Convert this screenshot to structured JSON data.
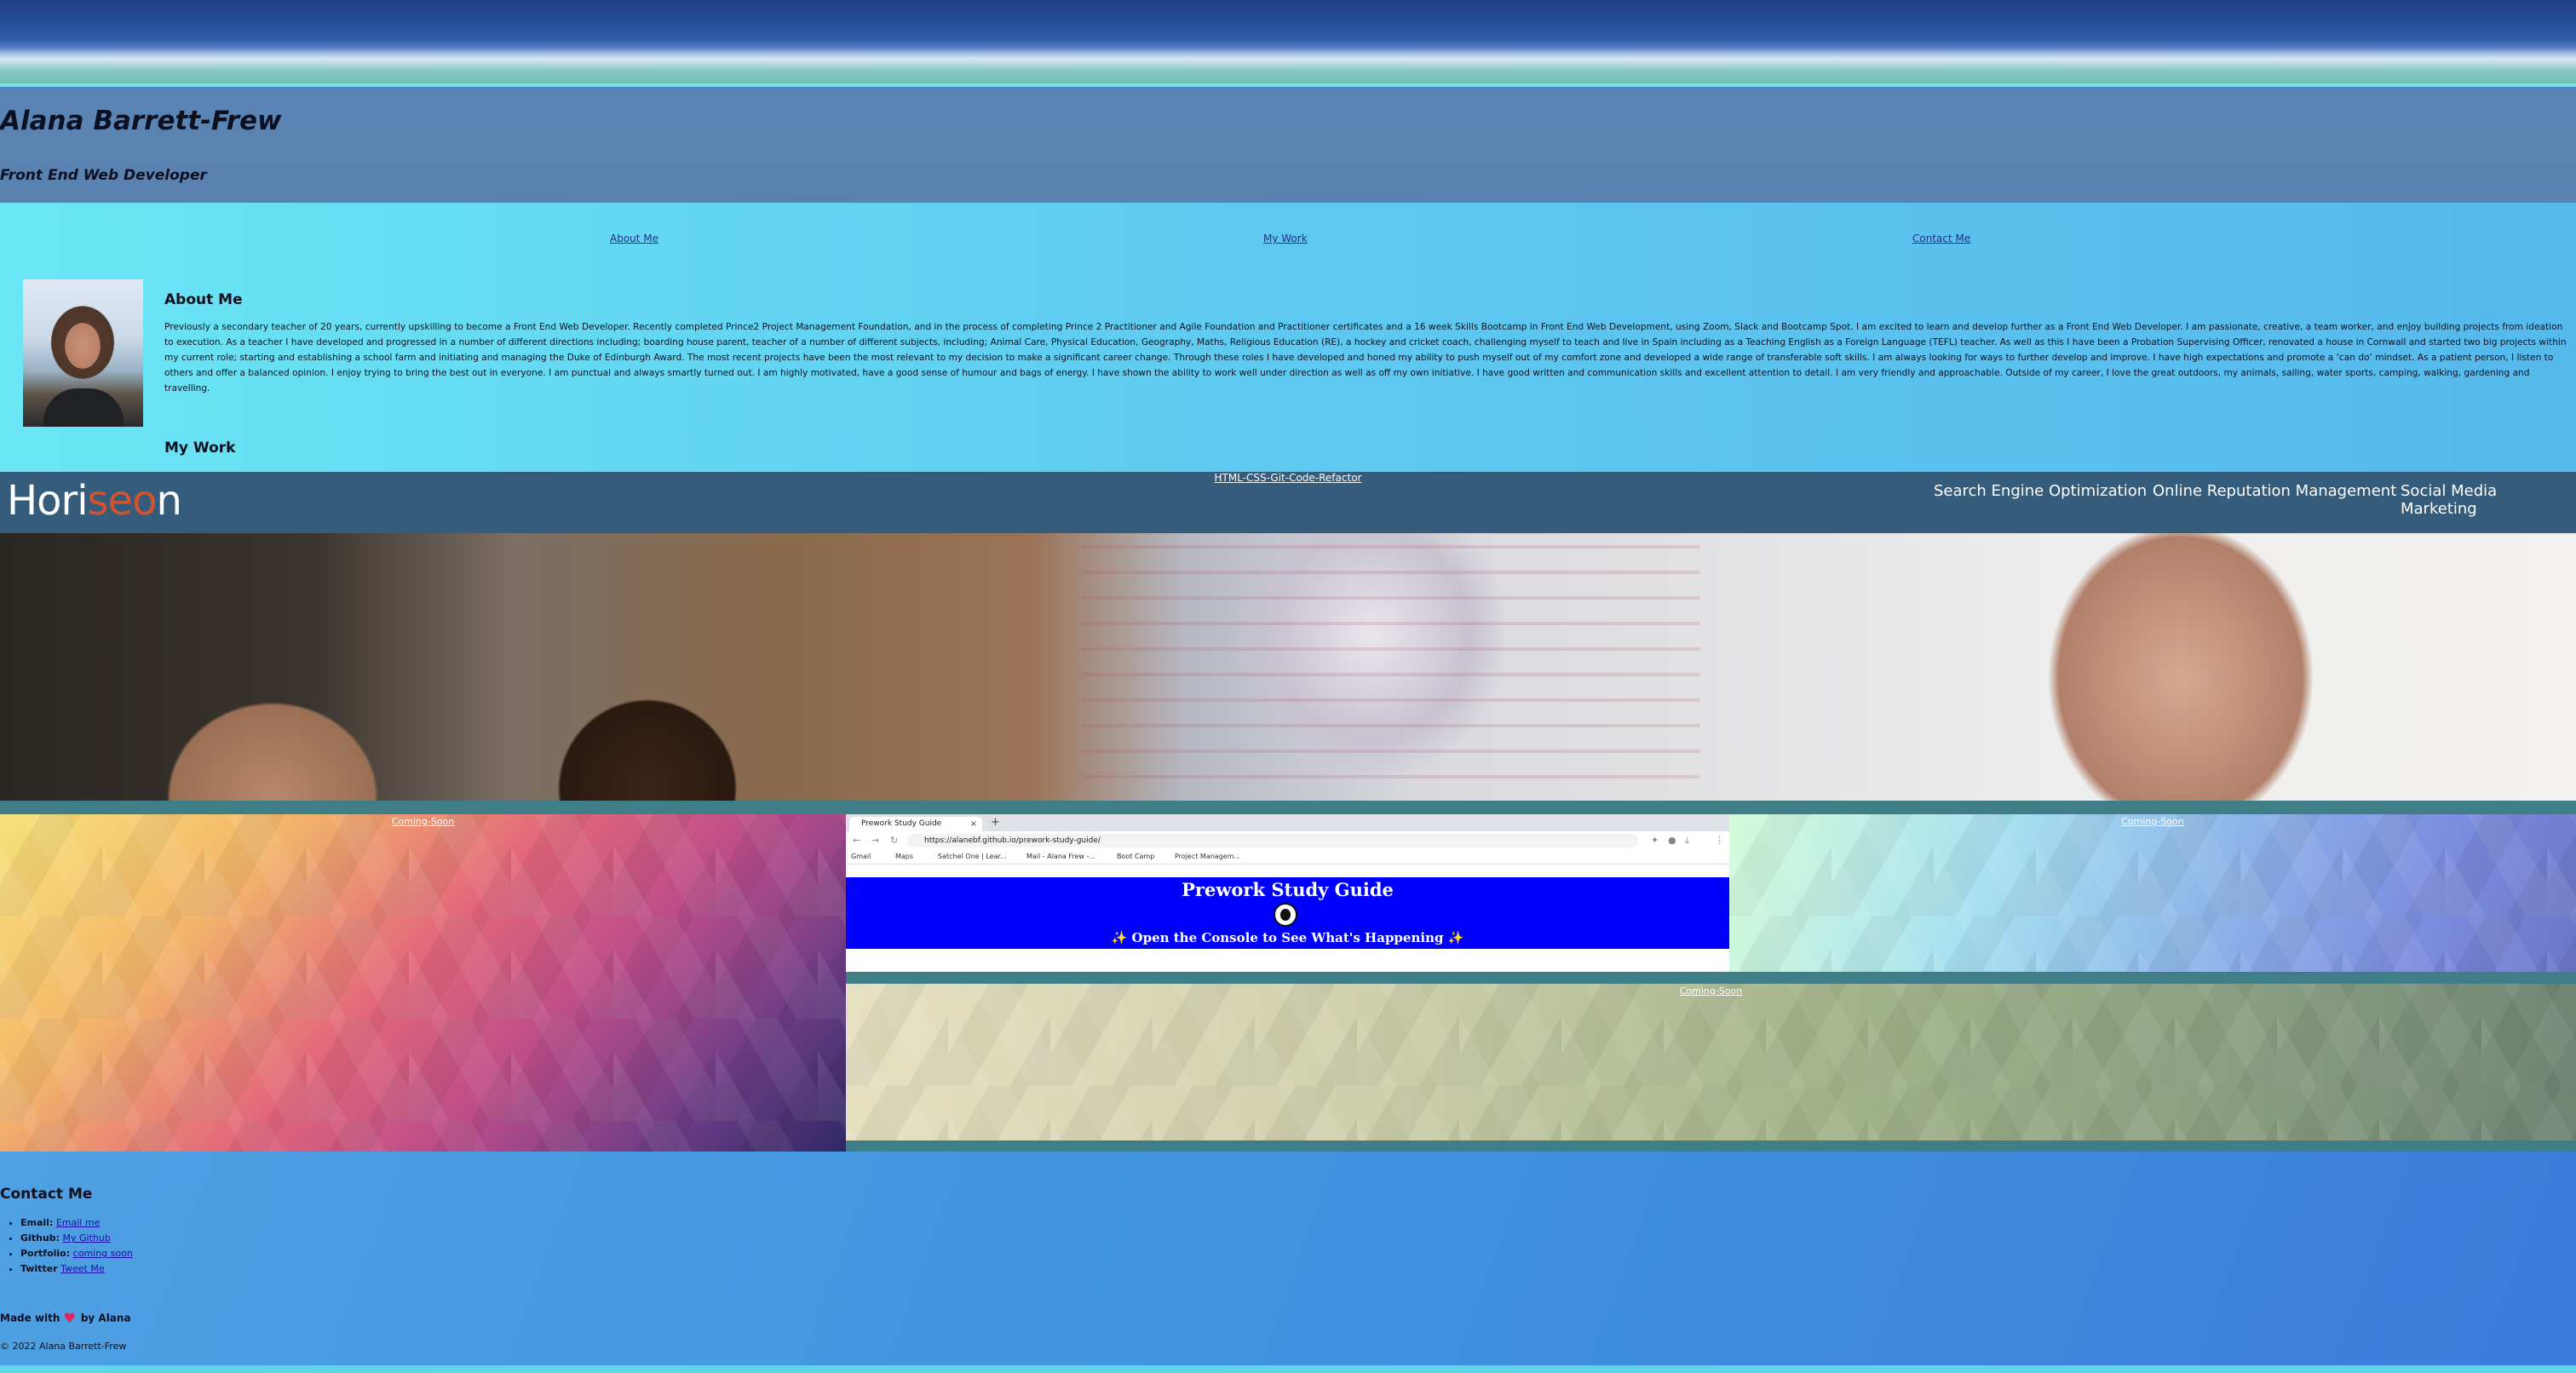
{
  "header": {
    "name": "Alana Barrett-Frew",
    "role": "Front End Web Developer"
  },
  "nav": {
    "items": [
      {
        "label": "About Me"
      },
      {
        "label": "My Work"
      },
      {
        "label": "Contact Me"
      }
    ]
  },
  "about": {
    "heading": "About Me",
    "text": "Previously a secondary teacher of 20 years, currently upskilling to become a Front End Web Developer. Recently completed Prince2 Project Management Foundation, and in the process of completing Prince 2 Practitioner and Agile Foundation and Practitioner certificates and a 16 week Skills Bootcamp in Front End Web Development, using Zoom, Slack and Bootcamp Spot. I am excited to learn and develop further as a Front End Web Developer. I am passionate, creative, a team worker, and enjoy building projects from ideation to execution. As a teacher I have developed and progressed in a number of different directions including; boarding house parent, teacher of a number of different subjects, including; Animal Care, Physical Education, Geography, Maths, Religious Education (RE), a hockey and cricket coach, challenging myself to teach and live in Spain including as a Teaching English as a Foreign Language (TEFL) teacher. As well as this I have been a Probation Supervising Officer, renovated a house in Cornwall and started two big projects within my current role; starting and establishing a school farm and initiating and managing the Duke of Edinburgh Award. The most recent projects have been the most relevant to my decision to make a significant career change. Through these roles I have developed and honed my ability to push myself out of my comfort zone and developed a wide range of transferable soft skills. I am always looking for ways to further develop and improve. I have high expectations and promote a ‘can do’ mindset. As a patient person, I listen to others and offer a balanced opinion. I enjoy trying to bring the best out in everyone. I am punctual and always smartly turned out. I am highly motivated, have a good sense of humour and bags of energy. I have shown the ability to work well under direction as well as off my own initiative. I have good written and communication skills and excellent attention to detail. I am very friendly and approachable. Outside of my career, I love the great outdoors, my animals, sailing, water sports, camping, walking, gardening and travelling."
  },
  "work": {
    "heading": "My Work",
    "featured": {
      "title": "HTML-CSS-Git-Code-Refactor",
      "logo_main": "Hori",
      "logo_accent": "seo",
      "logo_end": "n",
      "nav": [
        "Search Engine Optimization",
        "Online Reputation Management",
        "Social Media Marketing"
      ]
    },
    "projects": [
      {
        "label": "Coming-Soon"
      },
      {
        "label": "prework-study-guide"
      },
      {
        "label": "Coming-Soon"
      },
      {
        "label": "Coming-Soon"
      }
    ],
    "screenshot": {
      "tab_title": "Prework Study Guide",
      "url": "https://alanebf.github.io/prework-study-guide/",
      "bookmarks": [
        "Gmail",
        "Maps",
        "Satchel One | Lear...",
        "Mail - Alana Frew -...",
        "Boot Camp",
        "Project Managem..."
      ],
      "page_title": "Prework Study Guide",
      "page_subtitle": "✨ Open the Console to See What's Happening ✨"
    }
  },
  "contact": {
    "heading": "Contact Me",
    "items": [
      {
        "key": "Email:",
        "link": "Email me"
      },
      {
        "key": "Github:",
        "link": "My Github"
      },
      {
        "key": "Portfolio:",
        "link": "coming soon"
      },
      {
        "key": "Twitter",
        "link": "Tweet Me"
      }
    ]
  },
  "footer": {
    "made_prefix": "Made with",
    "made_suffix": "by Alana",
    "copyright": "© 2022 Alana Barrett-Frew"
  }
}
